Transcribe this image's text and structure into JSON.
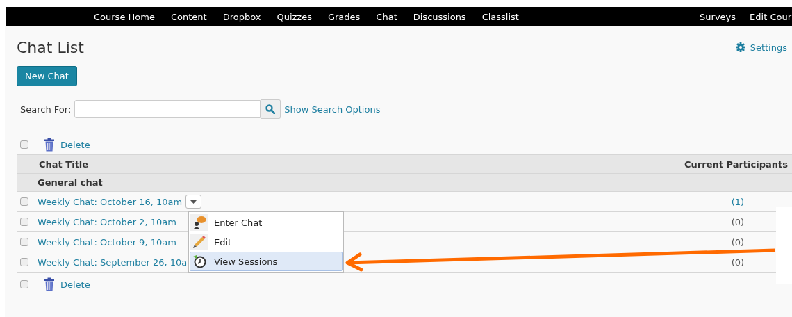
{
  "nav": {
    "items": [
      "Course Home",
      "Content",
      "Dropbox",
      "Quizzes",
      "Grades",
      "Chat",
      "Discussions",
      "Classlist"
    ],
    "right_items": [
      "Surveys",
      "Edit Cour"
    ]
  },
  "page_title": "Chat List",
  "settings_link": "Settings",
  "new_chat_button": "New Chat",
  "search": {
    "label": "Search For:",
    "options_link": "Show Search Options"
  },
  "bulk_actions_top": {
    "checked": false,
    "delete": "Delete"
  },
  "table": {
    "columns": [
      "Chat Title",
      "Current Participants"
    ],
    "group": "General chat",
    "rows": [
      {
        "title": "Weekly Chat: October 16, 10am",
        "participants": "(1)",
        "participants_linked": true,
        "checked": false,
        "menu_button": true
      },
      {
        "title": "Weekly Chat: October 2, 10am",
        "participants": "(0)",
        "participants_linked": false,
        "checked": false,
        "menu_button": false
      },
      {
        "title": "Weekly Chat: October 9, 10am",
        "participants": "(0)",
        "participants_linked": false,
        "checked": false,
        "menu_button": false
      },
      {
        "title": "Weekly Chat: September 26, 10a",
        "participants": "(0)",
        "participants_linked": false,
        "checked": false,
        "menu_button": false
      }
    ]
  },
  "bulk_actions_bottom": {
    "checked": false,
    "delete": "Delete"
  },
  "context_menu": {
    "items": [
      {
        "kind": "enter",
        "label": "Enter Chat",
        "selected": false
      },
      {
        "kind": "edit",
        "label": "Edit",
        "selected": false
      },
      {
        "kind": "sessions",
        "label": "View Sessions",
        "selected": true
      }
    ]
  }
}
